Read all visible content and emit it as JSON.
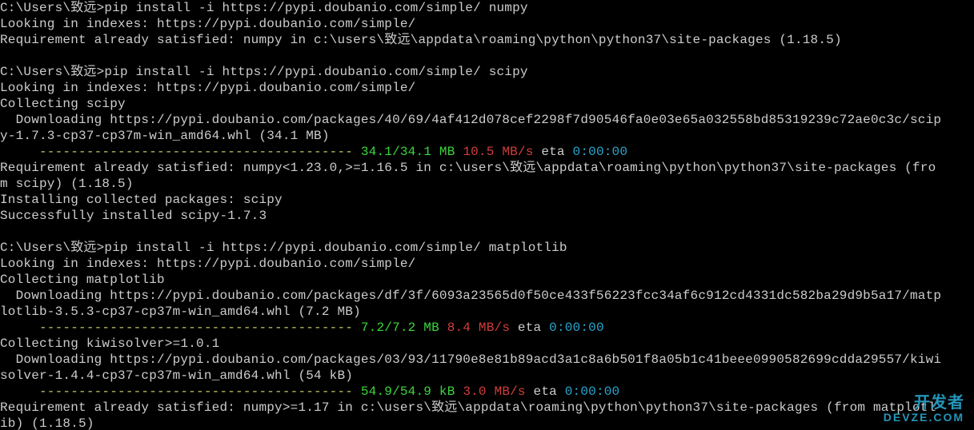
{
  "terminal": {
    "lines": [
      [
        {
          "cls": "white",
          "txt": "C:\\Users\\致远>pip install -i https://pypi.doubanio.com/simple/ numpy"
        }
      ],
      [
        {
          "cls": "white",
          "txt": "Looking in indexes: https://pypi.doubanio.com/simple/"
        }
      ],
      [
        {
          "cls": "white",
          "txt": "Requirement already satisfied: numpy in c:\\users\\致远\\appdata\\roaming\\python\\python37\\site-packages (1.18.5)"
        }
      ],
      [],
      [
        {
          "cls": "white",
          "txt": "C:\\Users\\致远>pip install -i https://pypi.doubanio.com/simple/ scipy"
        }
      ],
      [
        {
          "cls": "white",
          "txt": "Looking in indexes: https://pypi.doubanio.com/simple/"
        }
      ],
      [
        {
          "cls": "white",
          "txt": "Collecting scipy"
        }
      ],
      [
        {
          "cls": "white",
          "txt": "  Downloading https://pypi.doubanio.com/packages/40/69/4af412d078cef2298f7d90546fa0e03e65a032558bd85319239c72ae0c3c/scip"
        }
      ],
      [
        {
          "cls": "white",
          "txt": "y-1.7.3-cp37-cp37m-win_amd64.whl (34.1 MB)"
        }
      ],
      [
        {
          "cls": "yellow",
          "txt": "     ---------------------------------------- "
        },
        {
          "cls": "green",
          "txt": "34.1/34.1 MB"
        },
        {
          "cls": "white",
          "txt": " "
        },
        {
          "cls": "red",
          "txt": "10.5 MB/s"
        },
        {
          "cls": "white",
          "txt": " eta "
        },
        {
          "cls": "cyan",
          "txt": "0:00:00"
        }
      ],
      [
        {
          "cls": "white",
          "txt": "Requirement already satisfied: numpy<1.23.0,>=1.16.5 in c:\\users\\致远\\appdata\\roaming\\python\\python37\\site-packages (fro"
        }
      ],
      [
        {
          "cls": "white",
          "txt": "m scipy) (1.18.5)"
        }
      ],
      [
        {
          "cls": "white",
          "txt": "Installing collected packages: scipy"
        }
      ],
      [
        {
          "cls": "white",
          "txt": "Successfully installed scipy-1.7.3"
        }
      ],
      [],
      [
        {
          "cls": "white",
          "txt": "C:\\Users\\致远>pip install -i https://pypi.doubanio.com/simple/ matplotlib"
        }
      ],
      [
        {
          "cls": "white",
          "txt": "Looking in indexes: https://pypi.doubanio.com/simple/"
        }
      ],
      [
        {
          "cls": "white",
          "txt": "Collecting matplotlib"
        }
      ],
      [
        {
          "cls": "white",
          "txt": "  Downloading https://pypi.doubanio.com/packages/df/3f/6093a23565d0f50ce433f56223fcc34af6c912cd4331dc582ba29d9b5a17/matp"
        }
      ],
      [
        {
          "cls": "white",
          "txt": "lotlib-3.5.3-cp37-cp37m-win_amd64.whl (7.2 MB)"
        }
      ],
      [
        {
          "cls": "yellow",
          "txt": "     ---------------------------------------- "
        },
        {
          "cls": "green",
          "txt": "7.2/7.2 MB"
        },
        {
          "cls": "white",
          "txt": " "
        },
        {
          "cls": "red",
          "txt": "8.4 MB/s"
        },
        {
          "cls": "white",
          "txt": " eta "
        },
        {
          "cls": "cyan",
          "txt": "0:00:00"
        }
      ],
      [
        {
          "cls": "white",
          "txt": "Collecting kiwisolver>=1.0.1"
        }
      ],
      [
        {
          "cls": "white",
          "txt": "  Downloading https://pypi.doubanio.com/packages/03/93/11790e8e81b89acd3a1c8a6b501f8a05b1c41beee0990582699cdda29557/kiwi"
        }
      ],
      [
        {
          "cls": "white",
          "txt": "solver-1.4.4-cp37-cp37m-win_amd64.whl (54 kB)"
        }
      ],
      [
        {
          "cls": "yellow",
          "txt": "     ---------------------------------------- "
        },
        {
          "cls": "green",
          "txt": "54.9/54.9 kB"
        },
        {
          "cls": "white",
          "txt": " "
        },
        {
          "cls": "red",
          "txt": "3.0 MB/s"
        },
        {
          "cls": "white",
          "txt": " eta "
        },
        {
          "cls": "cyan",
          "txt": "0:00:00"
        }
      ],
      [
        {
          "cls": "white",
          "txt": "Requirement already satisfied: numpy>=1.17 in c:\\users\\致远\\appdata\\roaming\\python\\python37\\site-packages (from matplotl"
        }
      ],
      [
        {
          "cls": "white",
          "txt": "ib) (1.18.5)"
        }
      ]
    ]
  },
  "watermark": {
    "line1": "开发者",
    "line2": "DEVZE.COM"
  }
}
